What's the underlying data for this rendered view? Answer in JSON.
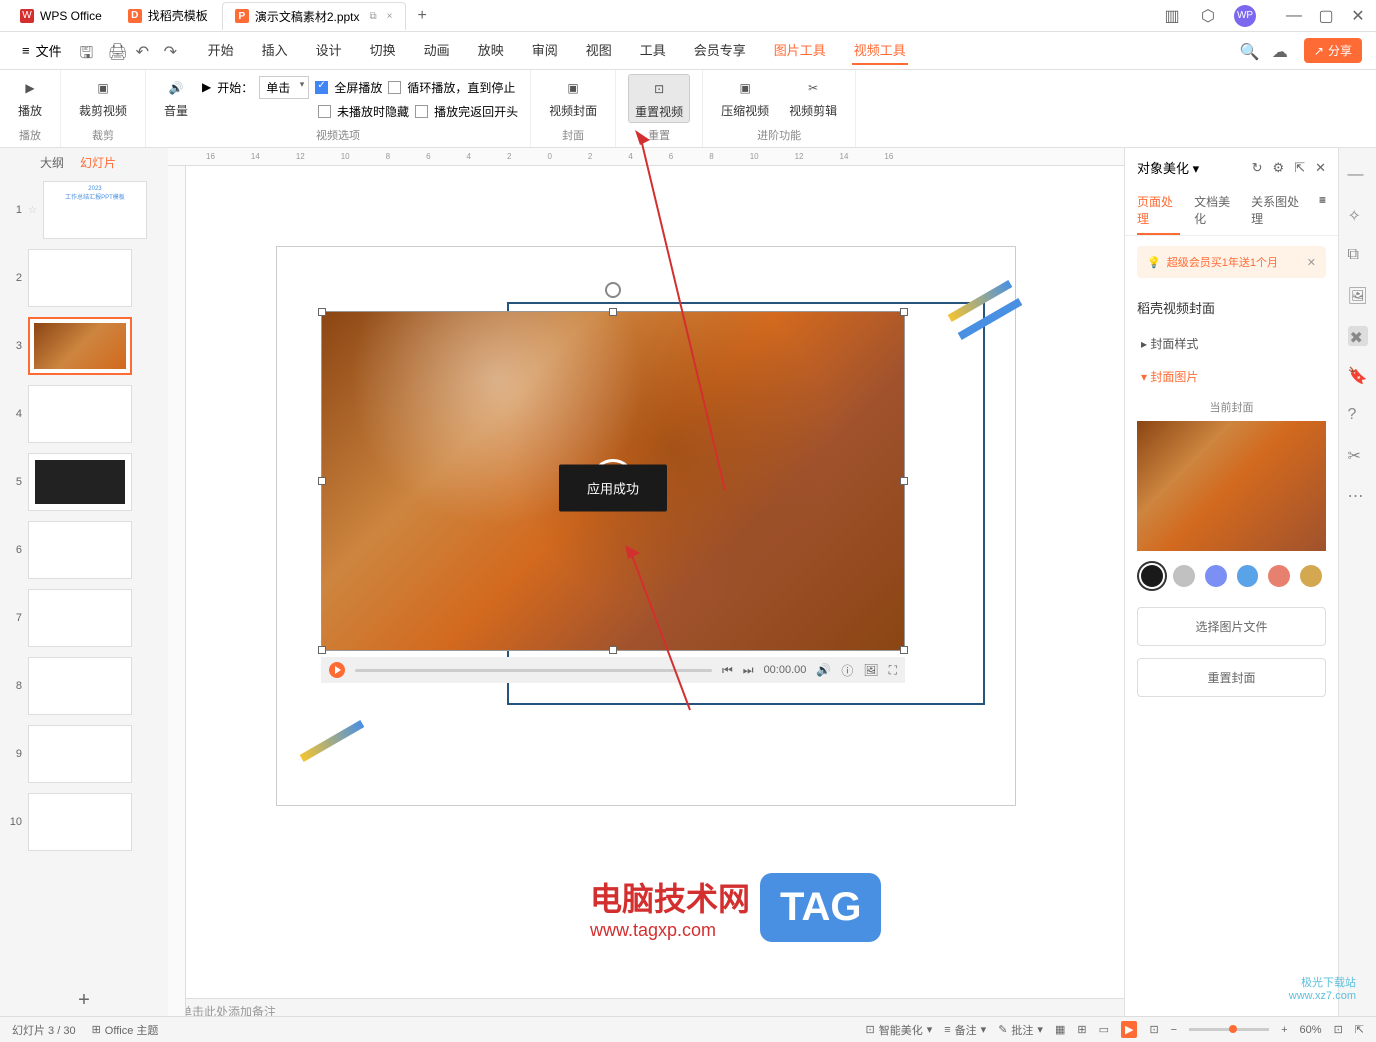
{
  "titlebar": {
    "tabs": [
      {
        "icon": "W",
        "label": "WPS Office"
      },
      {
        "icon": "D",
        "label": "找稻壳模板"
      },
      {
        "icon": "P",
        "label": "演示文稿素材2.pptx"
      }
    ],
    "add": "+"
  },
  "menu": {
    "file": "文件",
    "items": [
      "开始",
      "插入",
      "设计",
      "切换",
      "动画",
      "放映",
      "审阅",
      "视图",
      "工具",
      "会员专享",
      "图片工具",
      "视频工具"
    ],
    "share": "分享"
  },
  "ribbon": {
    "groups": [
      {
        "label": "播放",
        "buttons": [
          {
            "icon": "▶",
            "text": "播放"
          }
        ]
      },
      {
        "label": "裁剪",
        "buttons": [
          {
            "icon": "✂",
            "text": "裁剪视频"
          }
        ]
      },
      {
        "label": "视频选项",
        "volume": "音量",
        "start_label": "开始：",
        "start_value": "单击",
        "checks": [
          {
            "checked": true,
            "label": "全屏播放"
          },
          {
            "checked": false,
            "label": "循环播放，直到停止"
          },
          {
            "checked": false,
            "label": "未播放时隐藏"
          },
          {
            "checked": false,
            "label": "播放完返回开头"
          }
        ]
      },
      {
        "label": "封面",
        "buttons": [
          {
            "icon": "▣",
            "text": "视频封面"
          }
        ]
      },
      {
        "label": "重置",
        "buttons": [
          {
            "icon": "⊡",
            "text": "重置视频"
          }
        ]
      },
      {
        "label": "进阶功能",
        "buttons": [
          {
            "icon": "▣",
            "text": "压缩视频"
          },
          {
            "icon": "✂",
            "text": "视频剪辑"
          }
        ]
      }
    ]
  },
  "slides": {
    "tabs": [
      "大纲",
      "幻灯片"
    ],
    "count": 10
  },
  "canvas": {
    "toast": "应用成功",
    "time": "00:00.00",
    "notes_placeholder": "单击此处添加备注"
  },
  "right_panel": {
    "title": "对象美化",
    "tabs": [
      "页面处理",
      "文档美化",
      "关系图处理"
    ],
    "banner": "超级会员买1年送1个月",
    "section": "稻壳视频封面",
    "items": [
      "封面样式",
      "封面图片"
    ],
    "preview_label": "当前封面",
    "colors": [
      "#1a1a1a",
      "#c0c0c0",
      "#7b8ff5",
      "#5ba3e8",
      "#e88070",
      "#d4a850"
    ],
    "btn_select": "选择图片文件",
    "btn_reset": "重置封面"
  },
  "statusbar": {
    "slide_info": "幻灯片 3 / 30",
    "theme": "Office 主题",
    "smart": "智能美化",
    "notes": "备注",
    "comments": "批注",
    "zoom": "60%"
  },
  "watermark": {
    "line1": "极光下载站",
    "line2": "www.xz7.com"
  },
  "tag": {
    "text": "电脑技术网",
    "url": "www.tagxp.com",
    "box": "TAG"
  }
}
